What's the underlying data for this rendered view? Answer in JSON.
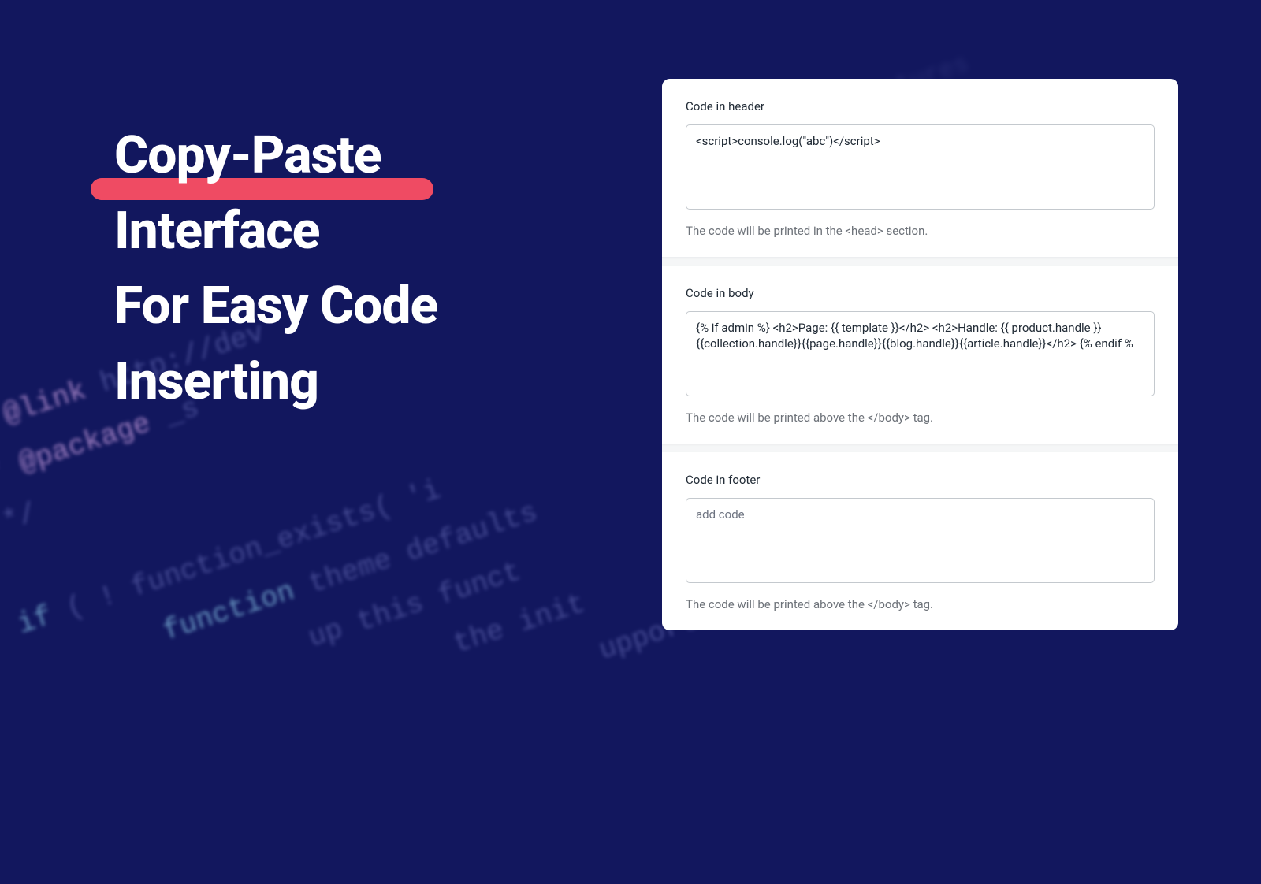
{
  "headline": {
    "line1": "Copy-Paste",
    "line2": "Interface",
    "line3": "For Easy Code",
    "line4": "Inserting"
  },
  "panel": {
    "header": {
      "label": "Code in header",
      "value": "<script>console.log(\"abc\")</script>",
      "caption": "The code will be printed in the <head> section."
    },
    "body": {
      "label": "Code in body",
      "value": "{% if admin %} <h2>Page: {{ template }}</h2> <h2>Handle: {{ product.handle }}{{collection.handle}}{{page.handle}}{{blog.handle}}{{article.handle}}</h2> {% endif %",
      "caption": "The code will be printed above the </body> tag."
    },
    "footer": {
      "label": "Code in footer",
      "placeholder": "add code",
      "value": "",
      "caption": "The code will be printed above the </body> tag."
    }
  },
  "bg_left": " *\n * @link http://dev\n * @package _s\n */\n\nif ( ! function_exists( 'i\n\tfunction theme defaults\n\t\tup this funct\n\t\t\tthe init\n\t\t\t\tupport",
  "bg_right": "features\n/**\npress\n */\n\n\nsetup()"
}
